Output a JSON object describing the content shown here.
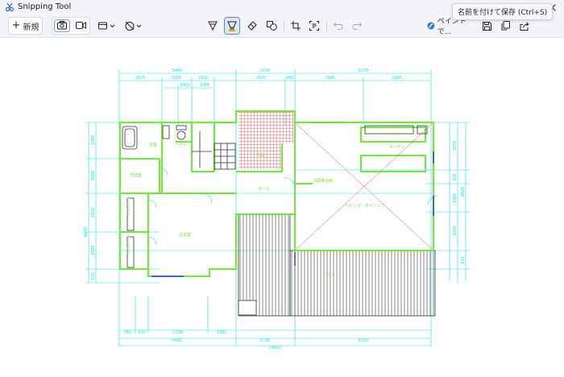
{
  "window": {
    "title": "Snipping Tool",
    "controls": [
      "minimize",
      "maximize",
      "close"
    ]
  },
  "tooltip": "名前を付けて保存 (Ctrl+S)",
  "toolbar": {
    "new_label": "新規",
    "paint_label": "ペイントで...",
    "tools": [
      "screenshot-mode",
      "video-mode",
      "snip-shape",
      "delay-timer",
      "ballpoint-pen",
      "highlighter",
      "eraser",
      "shapes",
      "crop",
      "text-actions",
      "undo",
      "redo",
      "open-in-paint",
      "save",
      "copy",
      "share"
    ]
  },
  "colors": {
    "plan_line": "#19e3e6",
    "wall": "#7be24a",
    "hatch": "#e8434b",
    "stroke_dark": "#333333"
  },
  "drawing": {
    "top_dims_row1": [
      "5460",
      "2730",
      "6370"
    ],
    "top_dims_row2": [
      "1975",
      "1365",
      "2120",
      "2070",
      "455",
      "3185",
      "3185"
    ],
    "top_dims_row3": [
      "1060",
      "1060"
    ],
    "bottom_dims_row1": [
      "750",
      "610",
      "2730",
      "1365"
    ],
    "bottom_dims_row2": [
      "5460",
      "2730",
      "6370"
    ],
    "bottom_total": "14560",
    "left_dims_outer": [
      "1360",
      "1680",
      "1820",
      "1820",
      "910"
    ],
    "left_dims_total": "6670",
    "right_dims_inner": [
      "2275",
      "455",
      "1365",
      "1820",
      "910"
    ],
    "right_dims_total": "6825",
    "rooms": [
      "浴室",
      "トイレ",
      "洗面室",
      "クロゼット",
      "クロゼット",
      "主寝室",
      "ホール",
      "キッチン",
      "冷蔵庫収納",
      "リビング・ダイニング",
      "ウッド",
      "吹抜"
    ]
  }
}
